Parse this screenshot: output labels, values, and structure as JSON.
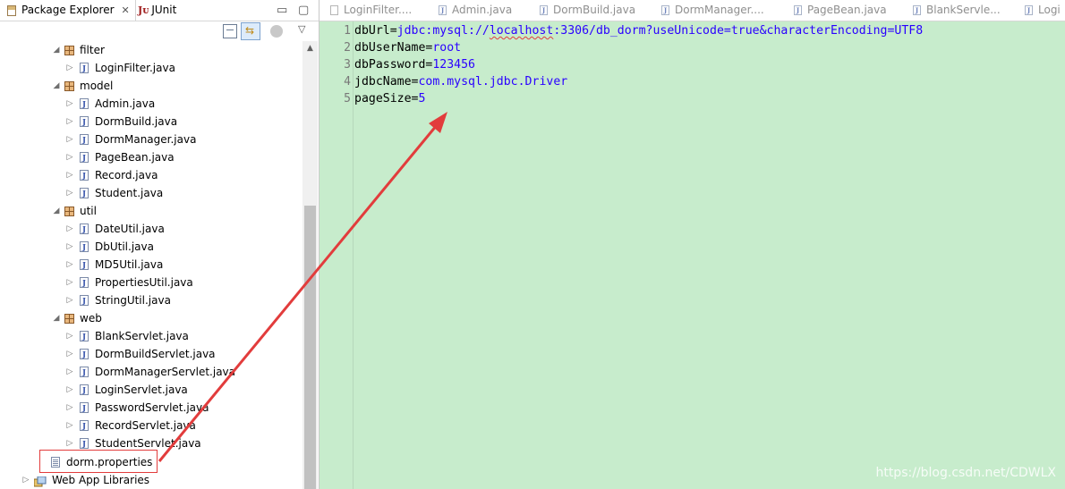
{
  "explorer": {
    "tabs": [
      {
        "label": "Package Explorer",
        "close": "✕"
      },
      {
        "label": "JUnit"
      }
    ],
    "tree": [
      {
        "type": "package",
        "label": "filter",
        "expanded": true
      },
      {
        "type": "java",
        "label": "LoginFilter.java"
      },
      {
        "type": "package",
        "label": "model",
        "expanded": true
      },
      {
        "type": "java",
        "label": "Admin.java"
      },
      {
        "type": "java",
        "label": "DormBuild.java"
      },
      {
        "type": "java",
        "label": "DormManager.java"
      },
      {
        "type": "java",
        "label": "PageBean.java"
      },
      {
        "type": "java",
        "label": "Record.java"
      },
      {
        "type": "java",
        "label": "Student.java"
      },
      {
        "type": "package",
        "label": "util",
        "expanded": true
      },
      {
        "type": "java",
        "label": "DateUtil.java"
      },
      {
        "type": "java",
        "label": "DbUtil.java"
      },
      {
        "type": "java",
        "label": "MD5Util.java"
      },
      {
        "type": "java",
        "label": "PropertiesUtil.java"
      },
      {
        "type": "java",
        "label": "StringUtil.java"
      },
      {
        "type": "package",
        "label": "web",
        "expanded": true
      },
      {
        "type": "java",
        "label": "BlankServlet.java"
      },
      {
        "type": "java",
        "label": "DormBuildServlet.java"
      },
      {
        "type": "java",
        "label": "DormManagerServlet.java"
      },
      {
        "type": "java",
        "label": "LoginServlet.java"
      },
      {
        "type": "java",
        "label": "PasswordServlet.java"
      },
      {
        "type": "java",
        "label": "RecordServlet.java"
      },
      {
        "type": "java",
        "label": "StudentServlet.java"
      },
      {
        "type": "properties",
        "label": "dorm.properties",
        "selected": true
      },
      {
        "type": "library",
        "label": "Web App Libraries"
      }
    ]
  },
  "editor": {
    "tabs": [
      {
        "label": "LoginFilter....",
        "icon": "file"
      },
      {
        "label": "Admin.java",
        "icon": "java"
      },
      {
        "label": "DormBuild.java",
        "icon": "java"
      },
      {
        "label": "DormManager....",
        "icon": "java"
      },
      {
        "label": "PageBean.java",
        "icon": "java"
      },
      {
        "label": "BlankServle...",
        "icon": "java"
      },
      {
        "label": "Logi",
        "icon": "java"
      }
    ],
    "lines": [
      {
        "num": "1",
        "key": "dbUrl=",
        "pre": "jdbc:mysql://",
        "squig": "localhost",
        "post": ":3306/db_dorm?useUnicode=true&characterEncoding=UTF8"
      },
      {
        "num": "2",
        "key": "dbUserName=",
        "pre": "root",
        "squig": "",
        "post": ""
      },
      {
        "num": "3",
        "key": "dbPassword=",
        "pre": "123456",
        "squig": "",
        "post": ""
      },
      {
        "num": "4",
        "key": "jdbcName=",
        "pre": "com.mysql.jdbc.Driver",
        "squig": "",
        "post": ""
      },
      {
        "num": "5",
        "key": "pageSize=",
        "pre": "5",
        "squig": "",
        "post": ""
      }
    ],
    "background": "#c7eccc",
    "value_color": "#2a00ff"
  },
  "watermark": "https://blog.csdn.net/CDWLX",
  "annotation_color": "#e23c3c"
}
